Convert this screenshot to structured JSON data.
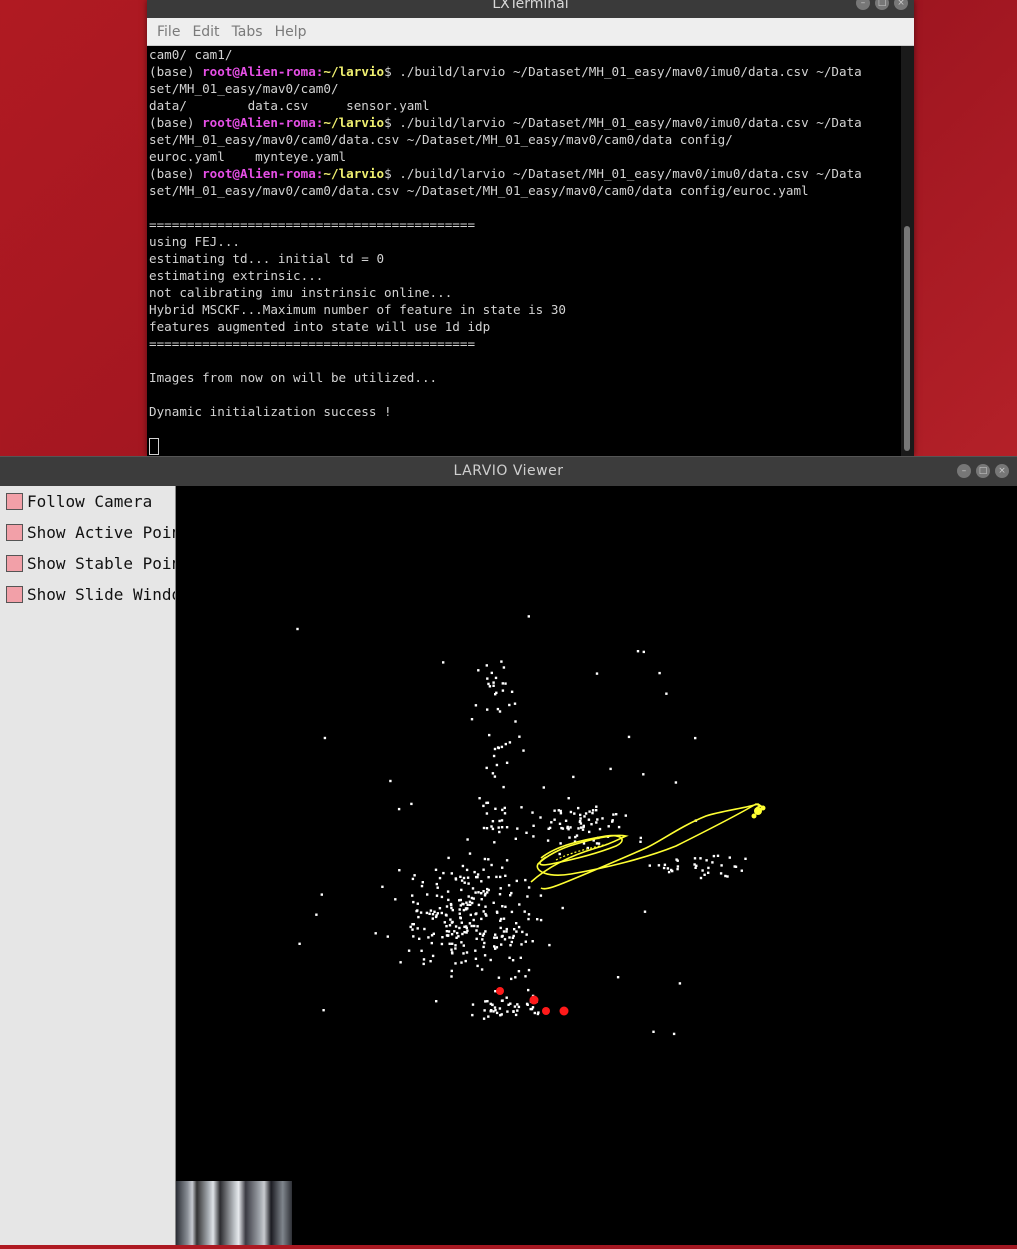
{
  "desktop": {
    "background_color": "#b01a22"
  },
  "terminal": {
    "title": "LXTerminal",
    "menu": [
      "File",
      "Edit",
      "Tabs",
      "Help"
    ],
    "lines": [
      {
        "type": "text",
        "text": "cam0/ cam1/"
      },
      {
        "type": "prompt",
        "prefix": "(base) ",
        "user": "root@Alien-roma:",
        "path": "~/larvio",
        "rest": "$ ./build/larvio ~/Dataset/MH_01_easy/mav0/imu0/data.csv ~/Data"
      },
      {
        "type": "text",
        "text": "set/MH_01_easy/mav0/cam0/"
      },
      {
        "type": "text",
        "text": "data/        data.csv     sensor.yaml"
      },
      {
        "type": "prompt",
        "prefix": "(base) ",
        "user": "root@Alien-roma:",
        "path": "~/larvio",
        "rest": "$ ./build/larvio ~/Dataset/MH_01_easy/mav0/imu0/data.csv ~/Data"
      },
      {
        "type": "text",
        "text": "set/MH_01_easy/mav0/cam0/data.csv ~/Dataset/MH_01_easy/mav0/cam0/data config/"
      },
      {
        "type": "text",
        "text": "euroc.yaml    mynteye.yaml"
      },
      {
        "type": "prompt",
        "prefix": "(base) ",
        "user": "root@Alien-roma:",
        "path": "~/larvio",
        "rest": "$ ./build/larvio ~/Dataset/MH_01_easy/mav0/imu0/data.csv ~/Data"
      },
      {
        "type": "text",
        "text": "set/MH_01_easy/mav0/cam0/data.csv ~/Dataset/MH_01_easy/mav0/cam0/data config/euroc.yaml"
      },
      {
        "type": "text",
        "text": ""
      },
      {
        "type": "text",
        "text": "==========================================="
      },
      {
        "type": "text",
        "text": "using FEJ..."
      },
      {
        "type": "text",
        "text": "estimating td... initial td = 0"
      },
      {
        "type": "text",
        "text": "estimating extrinsic..."
      },
      {
        "type": "text",
        "text": "not calibrating imu instrinsic online..."
      },
      {
        "type": "text",
        "text": "Hybrid MSCKF...Maximum number of feature in state is 30"
      },
      {
        "type": "text",
        "text": "features augmented into state will use 1d idp"
      },
      {
        "type": "text",
        "text": "==========================================="
      },
      {
        "type": "text",
        "text": ""
      },
      {
        "type": "text",
        "text": "Images from now on will be utilized..."
      },
      {
        "type": "text",
        "text": ""
      },
      {
        "type": "text",
        "text": "Dynamic initialization success !"
      },
      {
        "type": "text",
        "text": ""
      }
    ],
    "colors": {
      "user": "#e64fe6",
      "path": "#f0f070",
      "text": "#d3d3d3"
    }
  },
  "viewer": {
    "title": "LARVIO Viewer",
    "toggles": [
      {
        "label": "Follow Camera"
      },
      {
        "label": "Show Active Points"
      },
      {
        "label": "Show Stable Points"
      },
      {
        "label": "Show Slide Window"
      }
    ],
    "colors": {
      "points": "#ffffff",
      "trajectory": "#ffff33",
      "camera_poses": "#ff1a1a",
      "toggle": "#f2a0a8"
    }
  }
}
